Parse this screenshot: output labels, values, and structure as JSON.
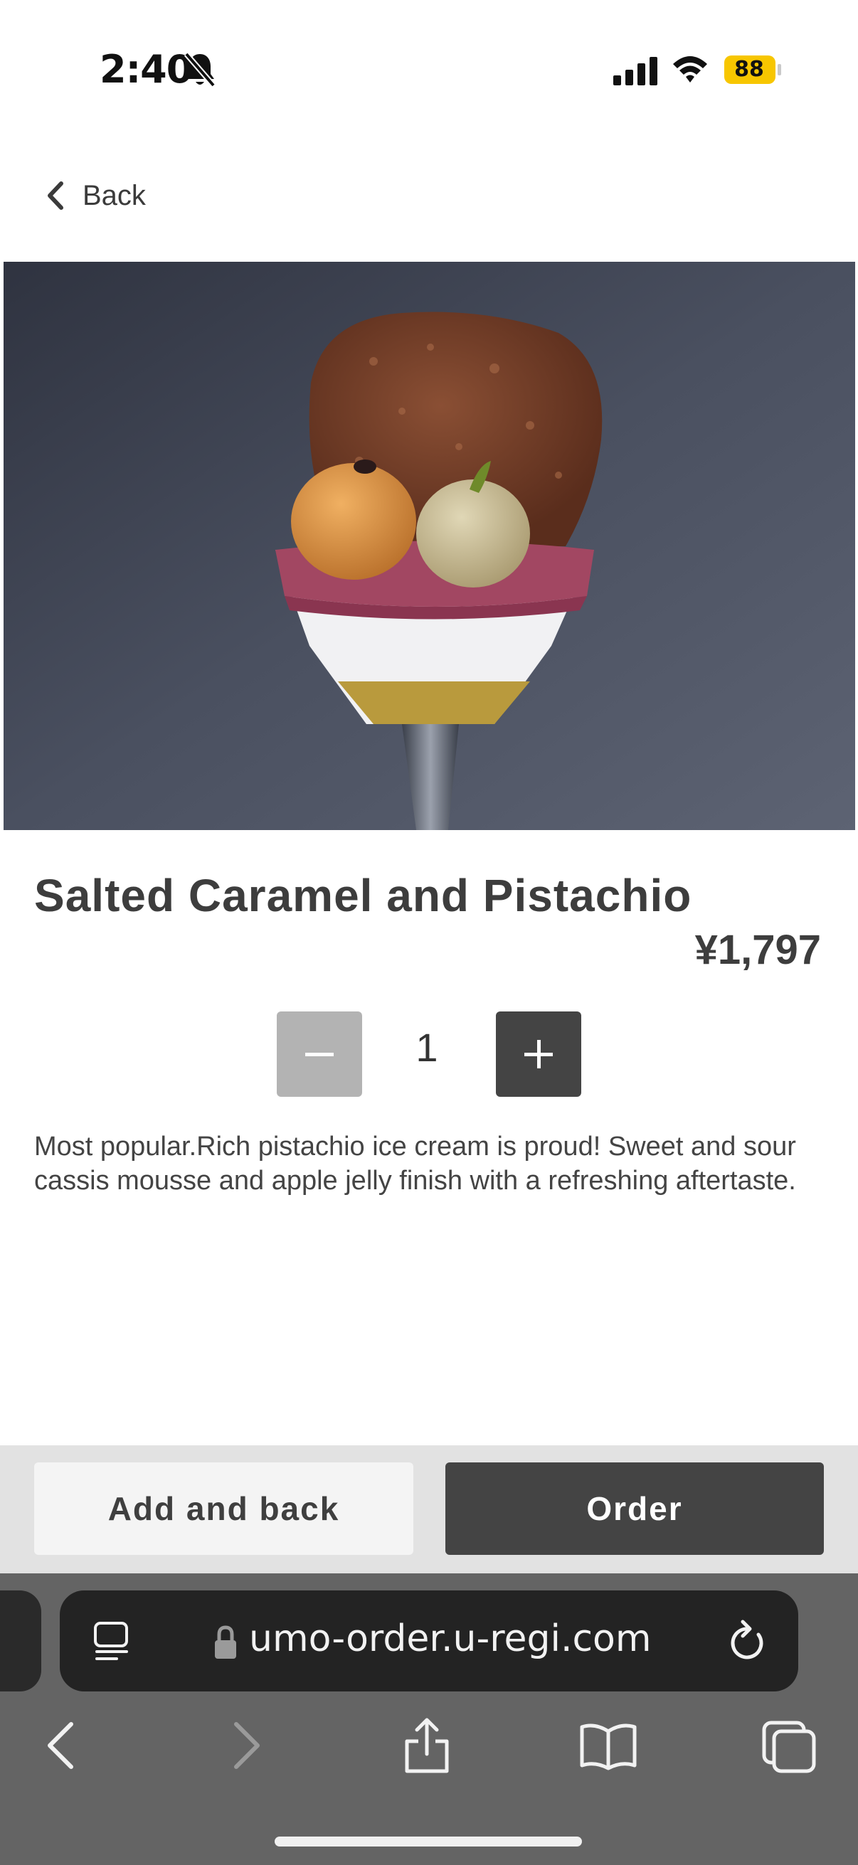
{
  "status_bar": {
    "time": "2:40",
    "battery_level": "88",
    "battery_color": "#f7c600",
    "icons": [
      "bell-slash-icon",
      "cellular-signal-icon",
      "wifi-icon",
      "battery-icon"
    ]
  },
  "nav": {
    "back_label": "Back"
  },
  "product": {
    "image_icon": "product-photo",
    "title": "Salted Caramel and Pistachio",
    "price": "¥1,797",
    "quantity": "1",
    "description": "Most popular.Rich pistachio ice cream is proud! Sweet and sour cassis mousse and apple jelly finish with a refreshing aftertaste."
  },
  "actions": {
    "add_back_label": "Add and back",
    "order_label": "Order"
  },
  "browser": {
    "url": "umo-order.u-regi.com",
    "icons": [
      "reader-icon",
      "lock-icon",
      "reload-icon",
      "back-arrow-icon",
      "forward-arrow-icon",
      "share-icon",
      "bookmarks-icon",
      "tabs-icon"
    ]
  },
  "colors": {
    "dark_button": "#444444",
    "disabled_button": "#b3b3b3",
    "action_bar": "#e2e2e2",
    "browser_chrome": "#646464"
  }
}
